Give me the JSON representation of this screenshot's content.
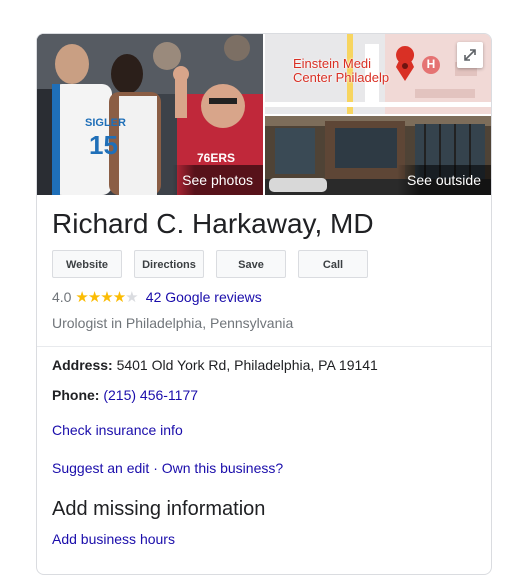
{
  "gallery": {
    "see_photos_label": "See photos",
    "see_outside_label": "See outside",
    "jersey_name": "SIGLER",
    "jersey_number": "15",
    "shirt_text": "76ERS",
    "map": {
      "label_line1": "Einstein Medi",
      "label_line2": "Center Philadelp",
      "hospital_letter": "H",
      "pin_color": "#d93025"
    }
  },
  "business": {
    "name": "Richard C. Harkaway, MD",
    "rating": "4.0",
    "rating_fraction": 0.8,
    "reviews_label": "42 Google reviews",
    "category": "Urologist in Philadelphia, Pennsylvania"
  },
  "actions": {
    "website": "Website",
    "directions": "Directions",
    "save": "Save",
    "call": "Call"
  },
  "details": {
    "address_label": "Address:",
    "address_value": "5401 Old York Rd, Philadelphia, PA 19141",
    "phone_label": "Phone:",
    "phone_value": "(215) 456-1177",
    "insurance_link": "Check insurance info",
    "suggest_edit": "Suggest an edit",
    "separator": "·",
    "own_business": "Own this business?"
  },
  "missing_info": {
    "title": "Add missing information",
    "add_hours": "Add business hours"
  },
  "colors": {
    "link": "#1a0dab",
    "star": "#fbbc04",
    "map_red": "#d93025"
  }
}
